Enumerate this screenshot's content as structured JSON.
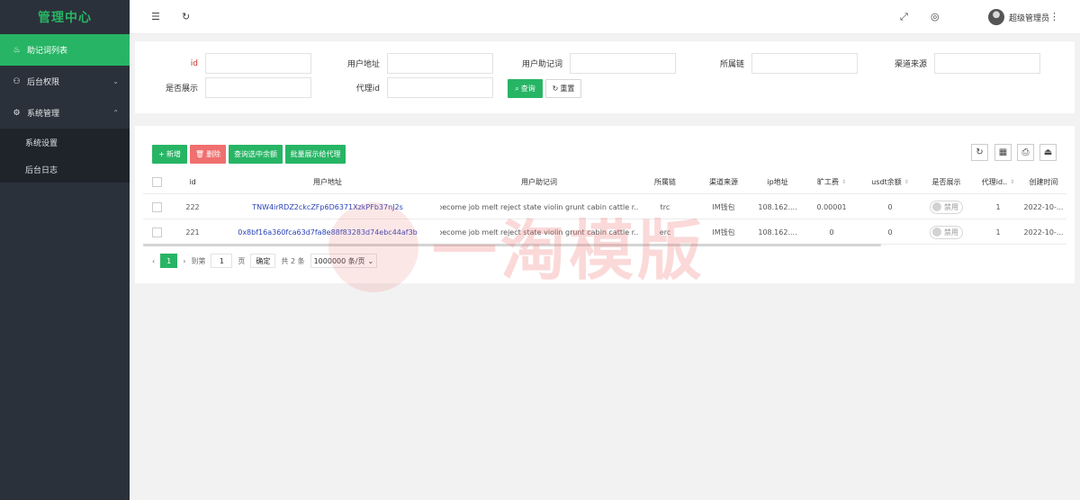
{
  "sidebar": {
    "title": "管理中心",
    "items": [
      {
        "label": "助记词列表",
        "icon": "flame-icon"
      },
      {
        "label": "后台权限",
        "icon": "user-icon"
      },
      {
        "label": "系统管理",
        "icon": "gear-icon"
      }
    ],
    "sub_items": [
      {
        "label": "系统设置"
      },
      {
        "label": "后台日志"
      }
    ]
  },
  "topbar": {
    "user_name": "超级管理员"
  },
  "search": {
    "fields": [
      {
        "label": "id"
      },
      {
        "label": "用户地址"
      },
      {
        "label": "用户助记词"
      },
      {
        "label": "所属链"
      },
      {
        "label": "渠道来源"
      },
      {
        "label": "是否展示"
      },
      {
        "label": "代理id"
      }
    ],
    "query_label": "查询",
    "reset_label": "重置"
  },
  "toolbar": {
    "add_label": "新增",
    "delete_label": "删除",
    "query_balance_label": "查询选中余额",
    "batch_label": "批量展示给代理"
  },
  "table": {
    "columns": [
      "id",
      "用户地址",
      "用户助记词",
      "所属链",
      "渠道来源",
      "ip地址",
      "旷工费",
      "usdt余额",
      "是否展示",
      "代理id..",
      "创建时间"
    ],
    "rows": [
      {
        "id": "222",
        "address": "TNW4irRDZ2ckcZFp6D6371XzkPFb37nJ2s",
        "mnemonic": "become job melt reject state violin grunt cabin cattle r...",
        "chain": "trc",
        "source": "IM钱包",
        "ip": "108.162....",
        "fee": "0.00001",
        "usdt": "0",
        "show": "禁用",
        "agent": "1",
        "created": "2022-10-..."
      },
      {
        "id": "221",
        "address": "0x8bf16a360fca63d7fa8e88f83283d74ebc44af3b",
        "mnemonic": "become job melt reject state violin grunt cabin cattle r...",
        "chain": "erc",
        "source": "IM钱包",
        "ip": "108.162....",
        "fee": "0",
        "usdt": "0",
        "show": "禁用",
        "agent": "1",
        "created": "2022-10-..."
      }
    ]
  },
  "pager": {
    "current": "1",
    "goto_label": "到第",
    "page_input": "1",
    "page_unit": "页",
    "confirm_label": "确定",
    "total_label": "共 2 条",
    "page_size": "1000000 条/页"
  },
  "watermark": "一淘模版",
  "colors": {
    "accent": "#27b565",
    "danger": "#f06f6f",
    "sidebar": "#2b313a",
    "link": "#2a43b8"
  }
}
